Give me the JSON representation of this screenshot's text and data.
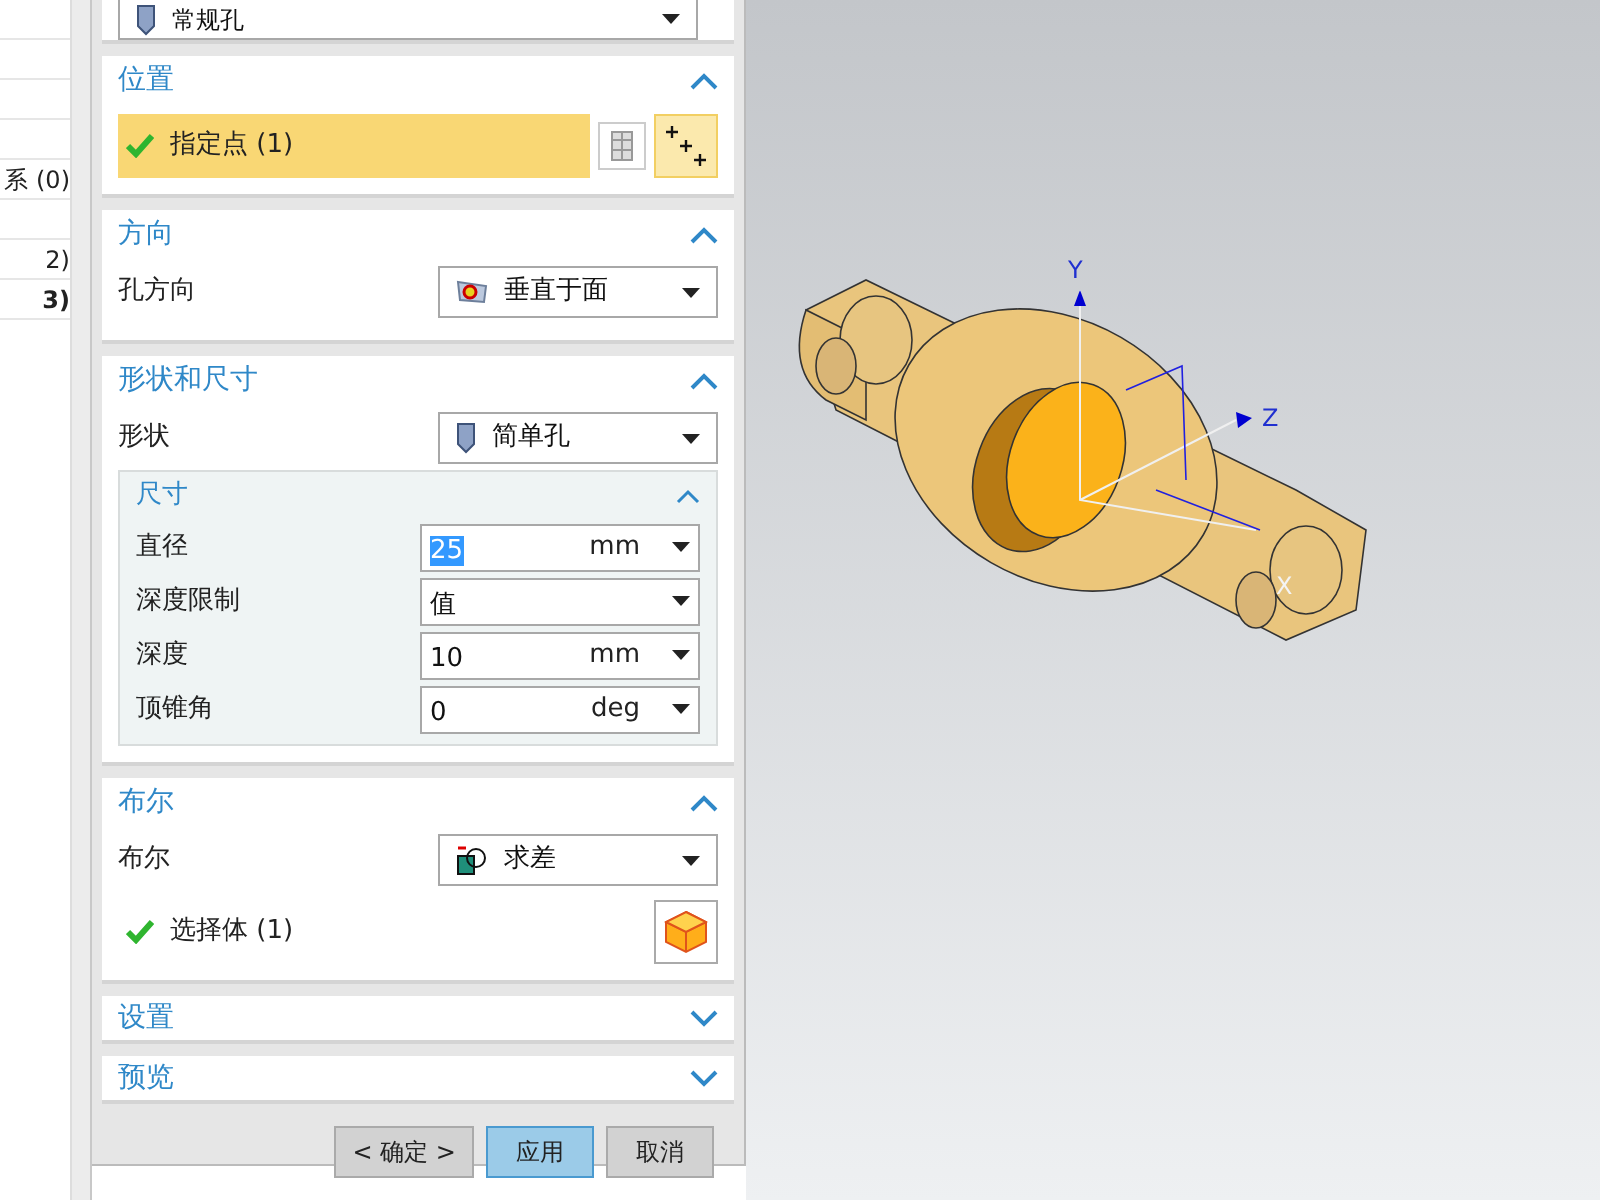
{
  "left_list": {
    "rows": [
      {
        "text": ""
      },
      {
        "text": ""
      },
      {
        "text": ""
      },
      {
        "text": ""
      },
      {
        "text": "系 (0)",
        "bold": false
      },
      {
        "text": ""
      },
      {
        "text": "2)",
        "bold": false
      },
      {
        "text": "3)",
        "bold": true
      }
    ]
  },
  "type_dropdown": {
    "value": "常规孔"
  },
  "sections": [
    {
      "kind": "position",
      "title": "位置",
      "expanded": true,
      "selection": {
        "label": "指定点 (1)",
        "done": true,
        "selected": true
      }
    },
    {
      "kind": "direction",
      "title": "方向",
      "expanded": true,
      "fields": [
        {
          "label": "孔方向",
          "value": "垂直于面"
        }
      ]
    },
    {
      "kind": "shape",
      "title": "形状和尺寸",
      "expanded": true,
      "fields": [
        {
          "label": "形状",
          "value": "简单孔"
        }
      ],
      "subsection": {
        "title": "尺寸",
        "expanded": true,
        "fields": [
          {
            "label": "直径",
            "value": "25",
            "unit": "mm",
            "highlighted": true
          },
          {
            "label": "深度限制",
            "value": "值"
          },
          {
            "label": "深度",
            "value": "10",
            "unit": "mm",
            "highlighted": false
          },
          {
            "label": "顶锥角",
            "value": "0",
            "unit": "deg",
            "highlighted": false
          }
        ]
      }
    },
    {
      "kind": "boolean",
      "title": "布尔",
      "expanded": true,
      "fields": [
        {
          "label": "布尔",
          "value": "求差"
        }
      ],
      "selection": {
        "label": "选择体 (1)",
        "done": true,
        "selected": false
      }
    },
    {
      "kind": "collapsed",
      "title": "设置",
      "expanded": false
    },
    {
      "kind": "collapsed",
      "title": "预览",
      "expanded": false
    }
  ],
  "buttons": [
    {
      "label": "< 确定 >",
      "primary": false
    },
    {
      "label": "应用",
      "primary": true
    },
    {
      "label": "取消",
      "primary": false
    }
  ],
  "viewport": {
    "axes": [
      "X",
      "Y",
      "Z"
    ]
  }
}
